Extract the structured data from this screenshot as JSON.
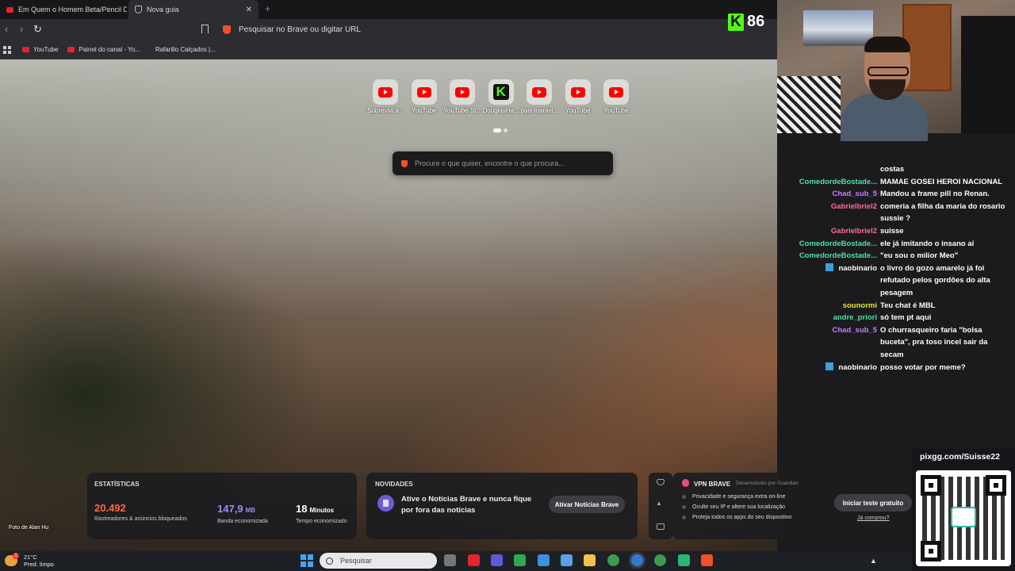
{
  "tabs": [
    {
      "title": "Em Quem o Homem Beta/Pencil De",
      "icon": "youtube-icon"
    },
    {
      "title": "Nova guia",
      "icon": "brave-shield-icon"
    }
  ],
  "address_bar": {
    "placeholder": "Pesquisar no Brave ou digitar URL"
  },
  "bookmarks": [
    {
      "label": "YouTube",
      "icon": "youtube-icon"
    },
    {
      "label": "Painel do canal - Yo...",
      "icon": "youtube-icon"
    },
    {
      "label": "Rafarillo Calçados |...",
      "icon": "none"
    }
  ],
  "kick_counter": {
    "count": "86"
  },
  "top_sites": [
    {
      "label": "Sobrevivi a...",
      "icon": "youtube"
    },
    {
      "label": "YouTube",
      "icon": "youtube"
    },
    {
      "label": "YouTube St...",
      "icon": "youtube"
    },
    {
      "label": "DouglasHa...",
      "icon": "kick"
    },
    {
      "label": "pais maravi...",
      "icon": "youtube"
    },
    {
      "label": "YouTube",
      "icon": "youtube"
    },
    {
      "label": "YouTube",
      "icon": "youtube"
    }
  ],
  "search": {
    "placeholder": "Procure o que quiser, encontre o que procura..."
  },
  "photo_credit": "Foto de Alan Hu",
  "stats": {
    "title": "ESTATÍSTICAS",
    "trackers": {
      "value": "20.492",
      "desc": "Rastreadores & anúncios bloqueados"
    },
    "bandwidth": {
      "value": "147,9",
      "unit": "MB",
      "desc": "Banda economizada"
    },
    "time": {
      "value": "18",
      "unit": "Minutos",
      "desc": "Tempo economizado"
    }
  },
  "news": {
    "title": "NOVIDADES",
    "text": "Ative o Notícias Brave e nunca fique por fora das notícias",
    "button": "Ativar Notícias Brave"
  },
  "vpn": {
    "title": "VPN BRAVE",
    "developer": "Desenvolvido por  Guardian",
    "features": [
      "Privacidade e segurança extra on-line",
      "Oculte seu IP e altere sua localização",
      "Proteja todos os apps do seu dispositivo"
    ],
    "button": "Iniciar teste gratuito",
    "link": "Já comprou?"
  },
  "taskbar": {
    "weather_temp": "21°C",
    "weather_desc": "Pred. limpo",
    "weather_alert": "1",
    "search_label": "Pesquisar"
  },
  "chat": [
    {
      "user": "",
      "color": "#ffffff",
      "text": "costas",
      "bot": false
    },
    {
      "user": "ComedordeBostade...",
      "color": "#4fe0a0",
      "text": "MAMAE GOSEI HEROI NACIONAL",
      "bot": false
    },
    {
      "user": "Chad_sub_5",
      "color": "#c77dff",
      "text": "Mandou a frame pill no Renan.",
      "bot": false
    },
    {
      "user": "Gabrielbriel2",
      "color": "#ff6b9a",
      "text": "comeria a filha da maria do rosario sussie ?",
      "bot": false
    },
    {
      "user": "Gabrielbriel2",
      "color": "#ff6b9a",
      "text": "suisse",
      "bot": false
    },
    {
      "user": "ComedordeBostade...",
      "color": "#4fe0a0",
      "text": "ele já imitando o insano aí",
      "bot": false
    },
    {
      "user": "ComedordeBostade...",
      "color": "#4fe0a0",
      "text": "\"eu sou o milior Meo\"",
      "bot": false
    },
    {
      "user": "naobinario",
      "color": "#ffffff",
      "text": "o livro do gozo amarelo já foi refutado pelos gordões do alta pesagem",
      "bot": true
    },
    {
      "user": "sounormi",
      "color": "#e6e63a",
      "text": "Teu chat é MBL",
      "bot": false
    },
    {
      "user": "andre_priori",
      "color": "#4fe0a0",
      "text": "só tem pt aqui",
      "bot": false
    },
    {
      "user": "Chad_sub_5",
      "color": "#c77dff",
      "text": "O churrasqueiro faria \"bolsa buceta\", pra toso incel sair da secam",
      "bot": false
    },
    {
      "user": "naobinario",
      "color": "#ffffff",
      "text": "posso votar por meme?",
      "bot": true
    }
  ],
  "pix": {
    "label": "pixgg.com/Suisse22"
  }
}
